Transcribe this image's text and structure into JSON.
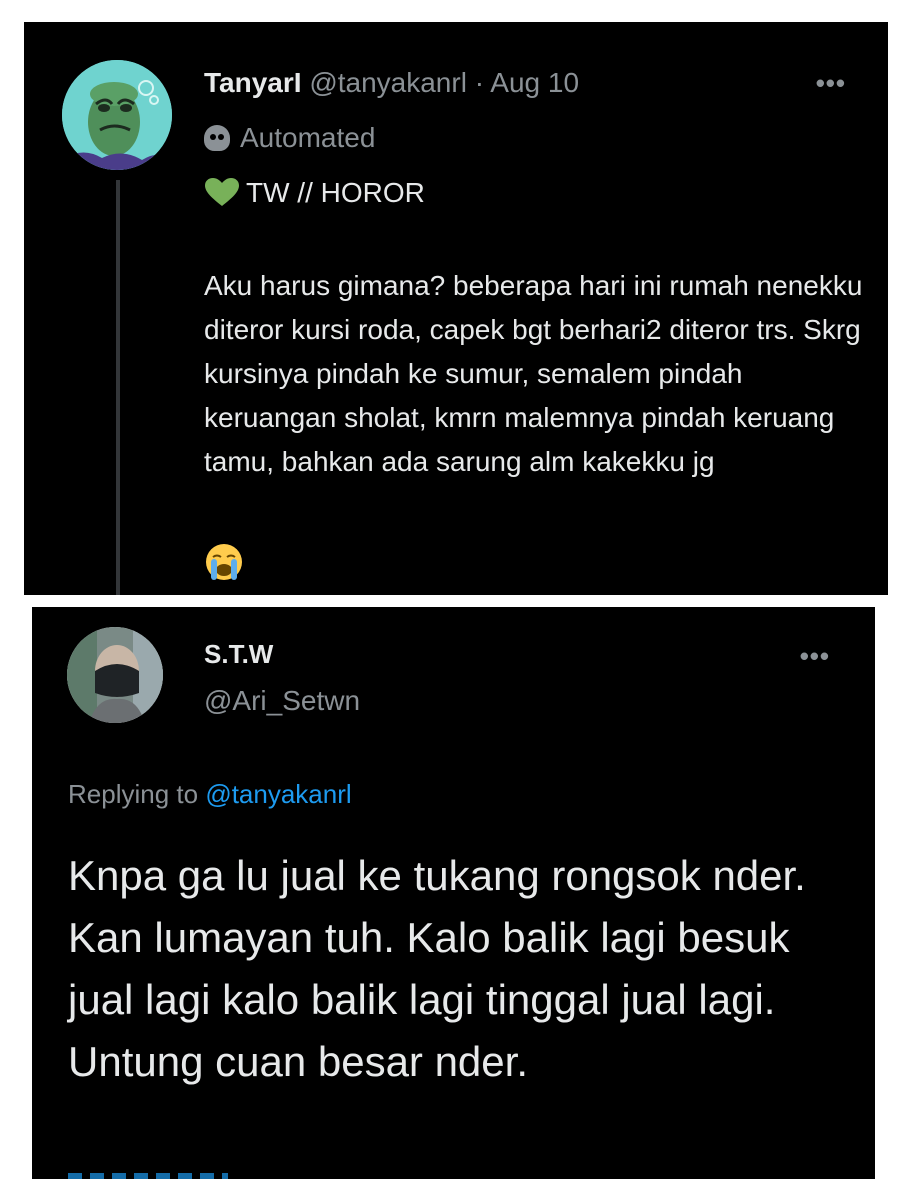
{
  "tweet1": {
    "display_name": "TanyarI",
    "handle": "@tanyakanrl",
    "separator": "·",
    "date": "Aug 10",
    "more_icon": "more-horizontal-icon",
    "automated_label": "Automated",
    "tw_label": "TW // HOROR",
    "body": "Aku harus gimana? beberapa hari ini rumah nenekku diteror kursi roda, capek bgt berhari2 diteror trs. Skrg kursinya pindah ke sumur, semalem pindah keruangan sholat, kmrn malemnya pindah keruang tamu, bahkan ada sarung alm kakekku jg",
    "emoji": "loudly-crying-face-icon"
  },
  "tweet2": {
    "display_name": "S.T.W",
    "handle": "@Ari_Setwn",
    "more_icon": "more-horizontal-icon",
    "replying_prefix": "Replying to",
    "replying_to": "@tanyakanrl",
    "body": "Knpa ga lu jual ke tukang rongsok nder. Kan lumayan tuh. Kalo balik lagi besuk jual lagi kalo balik lagi tinggal jual lagi. Untung cuan besar nder."
  },
  "colors": {
    "background": "#000000",
    "text": "#e7e9ea",
    "muted": "#8b9196",
    "link": "#1d9bf0",
    "heart": "#78b159"
  }
}
